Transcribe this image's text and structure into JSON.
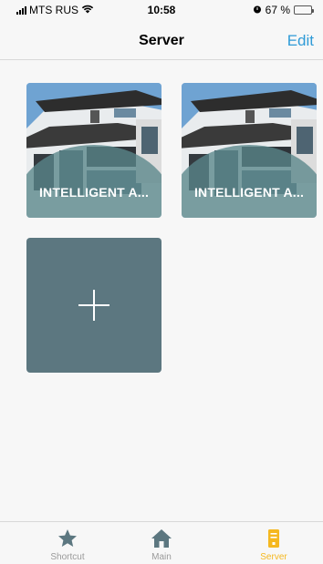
{
  "status_bar": {
    "carrier": "MTS RUS",
    "time": "10:58",
    "battery_percent": "67 %",
    "battery_level": 0.67,
    "icons": [
      "signal-icon",
      "wifi-icon",
      "alarm-icon",
      "battery-icon"
    ]
  },
  "nav": {
    "title": "Server",
    "edit_label": "Edit"
  },
  "servers": [
    {
      "label": "INTELLIGENT A...",
      "image": "modern-house-photo"
    },
    {
      "label": "INTELLIGENT A...",
      "image": "modern-house-photo"
    }
  ],
  "add_tile": {
    "icon": "plus-icon"
  },
  "tabs": [
    {
      "label": "Shortcut",
      "icon": "star-icon",
      "active": false
    },
    {
      "label": "Main",
      "icon": "home-icon",
      "active": false
    },
    {
      "label": "Server",
      "icon": "server-icon",
      "active": true
    }
  ],
  "colors": {
    "accent": "#f5b820",
    "link": "#2f9bd7",
    "tile": "#5c7780",
    "inactive": "#9a9a9a"
  }
}
